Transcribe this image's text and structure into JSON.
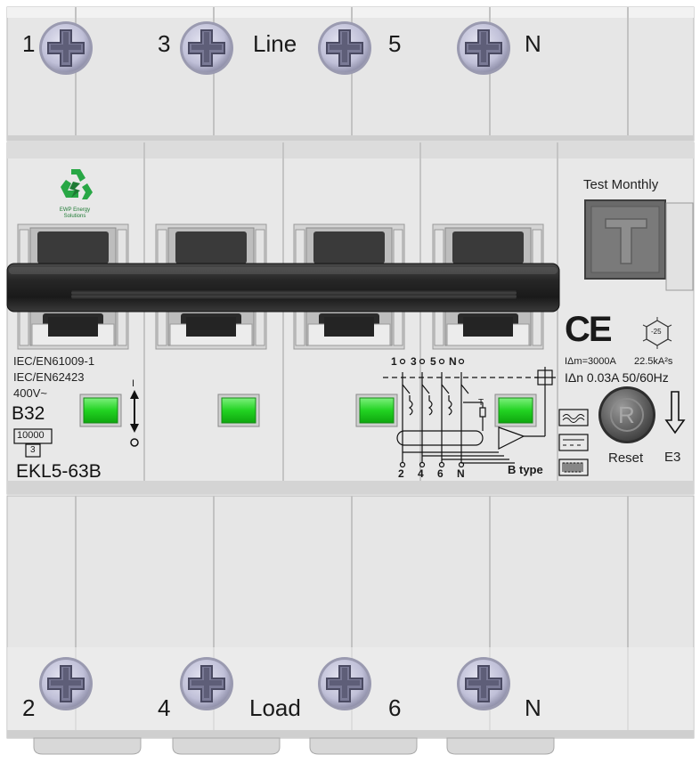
{
  "terminals": {
    "top": {
      "t1": "1",
      "t3": "3",
      "line": "Line",
      "t5": "5",
      "tn": "N"
    },
    "bottom": {
      "t2": "2",
      "t4": "4",
      "load": "Load",
      "t6": "6",
      "tn": "N"
    }
  },
  "logo": {
    "line1": "EWP Energy",
    "line2": "Solutions"
  },
  "test_button": {
    "caption": "Test Monthly",
    "letter": "T"
  },
  "reset_button": {
    "letter": "R",
    "label": "Reset"
  },
  "certification": {
    "ce": "CE",
    "temp_rating": "-25"
  },
  "ratings": {
    "im": "IΔm=3000A",
    "energy": "22.5kA²s",
    "idn": "IΔn 0.03A 50/60Hz",
    "class": "E3"
  },
  "left_label": {
    "std1": "IEC/EN61009-1",
    "std2": "IEC/EN62423",
    "voltage": "400V~",
    "curve": "B32",
    "breaking": "10000",
    "energy_class": "3",
    "model": "EKL5-63B"
  },
  "switch_position": {
    "on": "I",
    "off": "O"
  },
  "schematic": {
    "top_labels": [
      "1",
      "3",
      "5",
      "N"
    ],
    "bottom_labels": [
      "2",
      "4",
      "6",
      "N"
    ],
    "test_mark": "T",
    "type_label": "B type"
  },
  "colors": {
    "housing": "#e8e8e8",
    "indicator": "#22d322",
    "handle_bar": "#2b2b2b",
    "screw": "#c4c4dc"
  }
}
